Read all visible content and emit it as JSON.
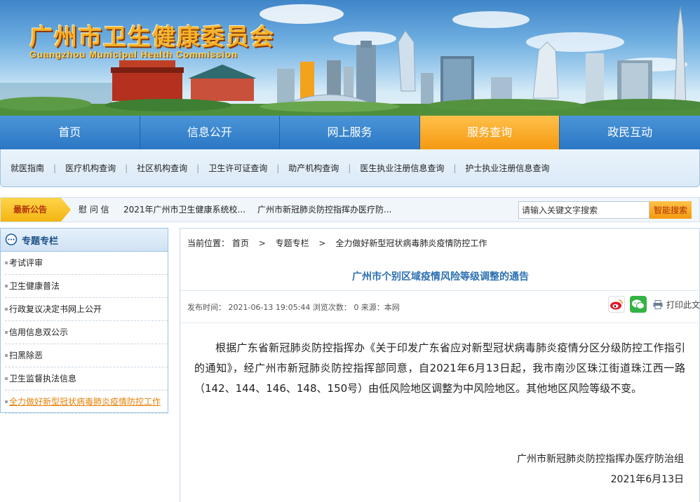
{
  "header": {
    "title_cn": "广州市卫生健康委员会",
    "title_en": "Guangzhou Municipal Health Commission"
  },
  "main_nav": [
    {
      "label": "首页",
      "active": false
    },
    {
      "label": "信息公开",
      "active": false
    },
    {
      "label": "网上服务",
      "active": false
    },
    {
      "label": "服务查询",
      "active": true
    },
    {
      "label": "政民互动",
      "active": false
    }
  ],
  "sub_nav": [
    "就医指南",
    "医疗机构查询",
    "社区机构查询",
    "卫生许可证查询",
    "助产机构查询",
    "医生执业注册信息查询",
    "护士执业注册信息查询"
  ],
  "notice": {
    "tag": "最新公告",
    "items": [
      "慰 问 信",
      "2021年广州市卫生健康系统校...",
      "广州市新冠肺炎防控指挥办医疗防..."
    ]
  },
  "search": {
    "value": "请输入关键文字搜索",
    "button": "智能搜索"
  },
  "sidebar": {
    "title": "专题专栏",
    "items": [
      {
        "label": "考试评审",
        "active": false
      },
      {
        "label": "卫生健康普法",
        "active": false
      },
      {
        "label": "行政复议决定书网上公开",
        "active": false
      },
      {
        "label": "信用信息双公示",
        "active": false
      },
      {
        "label": "扫黑除恶",
        "active": false
      },
      {
        "label": "卫生监督执法信息",
        "active": false
      },
      {
        "label": "全力做好新型冠状病毒肺炎疫情防控工作",
        "active": true
      }
    ]
  },
  "breadcrumb": {
    "prefix": "当前位置：",
    "items": [
      "首页",
      "专题专栏",
      "全力做好新型冠状病毒肺炎疫情防控工作"
    ],
    "separator": ">"
  },
  "article": {
    "title": "广州市个别区域疫情风险等级调整的通告",
    "meta": "发布时间： 2021-06-13 19:05:44   浏览次数： 0  来源：本网",
    "print_label": "打印此文",
    "body": "根据广东省新冠肺炎防控指挥办《关于印发广东省应对新型冠状病毒肺炎疫情分区分级防控工作指引的通知》，经广州市新冠肺炎防控指挥部同意，自2021年6月13日起，我市南沙区珠江街道珠江西一路（142、144、146、148、150号）由低风险地区调整为中风险地区。其他地区风险等级不变。",
    "signature_org": "广州市新冠肺炎防控指挥办医疗防治组",
    "signature_date": "2021年6月13日"
  },
  "colors": {
    "nav_blue": "#2b77c4",
    "nav_active_orange": "#f59a12",
    "title_blue": "#2c6fb0",
    "sidebar_active": "#e5830b"
  }
}
